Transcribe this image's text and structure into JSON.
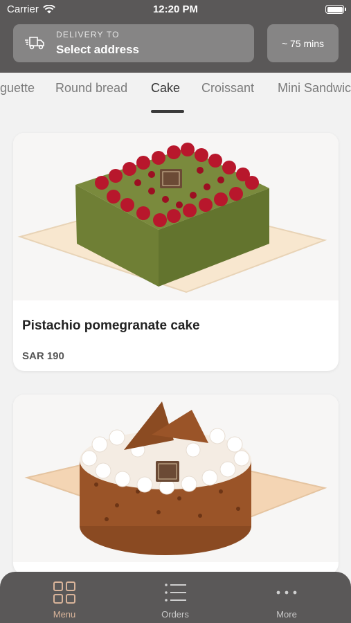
{
  "status_bar": {
    "carrier": "Carrier",
    "time": "12:20 PM"
  },
  "delivery": {
    "label": "DELIVERY TO",
    "address": "Select address",
    "eta": "~ 75 mins"
  },
  "tabs": [
    {
      "label": "Baguette",
      "active": false
    },
    {
      "label": "Round bread",
      "active": false
    },
    {
      "label": "Cake",
      "active": true
    },
    {
      "label": "Croissant",
      "active": false
    },
    {
      "label": "Mini Sandwich",
      "active": false
    }
  ],
  "products": [
    {
      "name": "Pistachio pomegranate cake",
      "price": "SAR 190"
    },
    {
      "name": "",
      "price": ""
    }
  ],
  "bottom_nav": [
    {
      "label": "Menu",
      "icon": "grid-icon",
      "active": true
    },
    {
      "label": "Orders",
      "icon": "list-icon",
      "active": false
    },
    {
      "label": "More",
      "icon": "more-dots-icon",
      "active": false
    }
  ],
  "colors": {
    "header_bg": "#5a5858",
    "active_nav": "#d9b49a"
  }
}
